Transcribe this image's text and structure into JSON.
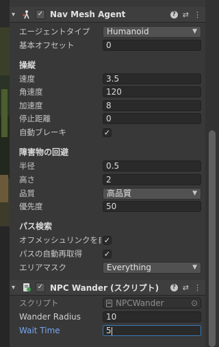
{
  "nav_mesh_agent": {
    "title": "Nav Mesh Agent",
    "enabled": "✓",
    "help_icon": "?",
    "presets_icon": "⇄",
    "menu_icon": "⋮",
    "agent_type": {
      "label": "エージェントタイプ",
      "value": "Humanoid"
    },
    "base_offset": {
      "label": "基本オフセット",
      "value": "0"
    },
    "steering": {
      "header": "操縦",
      "speed": {
        "label": "速度",
        "value": "3.5"
      },
      "angular_speed": {
        "label": "角速度",
        "value": "120"
      },
      "acceleration": {
        "label": "加速度",
        "value": "8"
      },
      "stopping_distance": {
        "label": "停止距離",
        "value": "0"
      },
      "auto_braking": {
        "label": "自動ブレーキ",
        "value": "✓"
      }
    },
    "obstacle_avoidance": {
      "header": "障害物の回避",
      "radius": {
        "label": "半径",
        "value": "0.5"
      },
      "height": {
        "label": "高さ",
        "value": "2"
      },
      "quality": {
        "label": "品質",
        "value": "高品質"
      },
      "priority": {
        "label": "優先度",
        "value": "50"
      }
    },
    "path_finding": {
      "header": "パス検索",
      "auto_traverse_offmesh": {
        "label": "オフメッシュリンクを自動移",
        "value": "✓"
      },
      "auto_repath": {
        "label": "パスの自動再取得",
        "value": "✓"
      },
      "area_mask": {
        "label": "エリアマスク",
        "value": "Everything"
      }
    }
  },
  "npc_wander": {
    "title": "NPC Wander (スクリプト)",
    "enabled": "✓",
    "help_icon": "?",
    "presets_icon": "⇄",
    "menu_icon": "⋮",
    "script": {
      "label": "スクリプト",
      "value": "NPCWander"
    },
    "wander_radius": {
      "label": "Wander Radius",
      "value": "10"
    },
    "wait_time": {
      "label": "Wait Time",
      "value": "5"
    }
  },
  "icons": {
    "fold": "▾",
    "dropdown_caret": "▼",
    "object_picker": "⊙"
  },
  "colors": {
    "panel_bg": "#383838",
    "field_bg": "#2a2a2a",
    "focus_border": "#3a79bb",
    "active_label": "#76a7ef"
  }
}
